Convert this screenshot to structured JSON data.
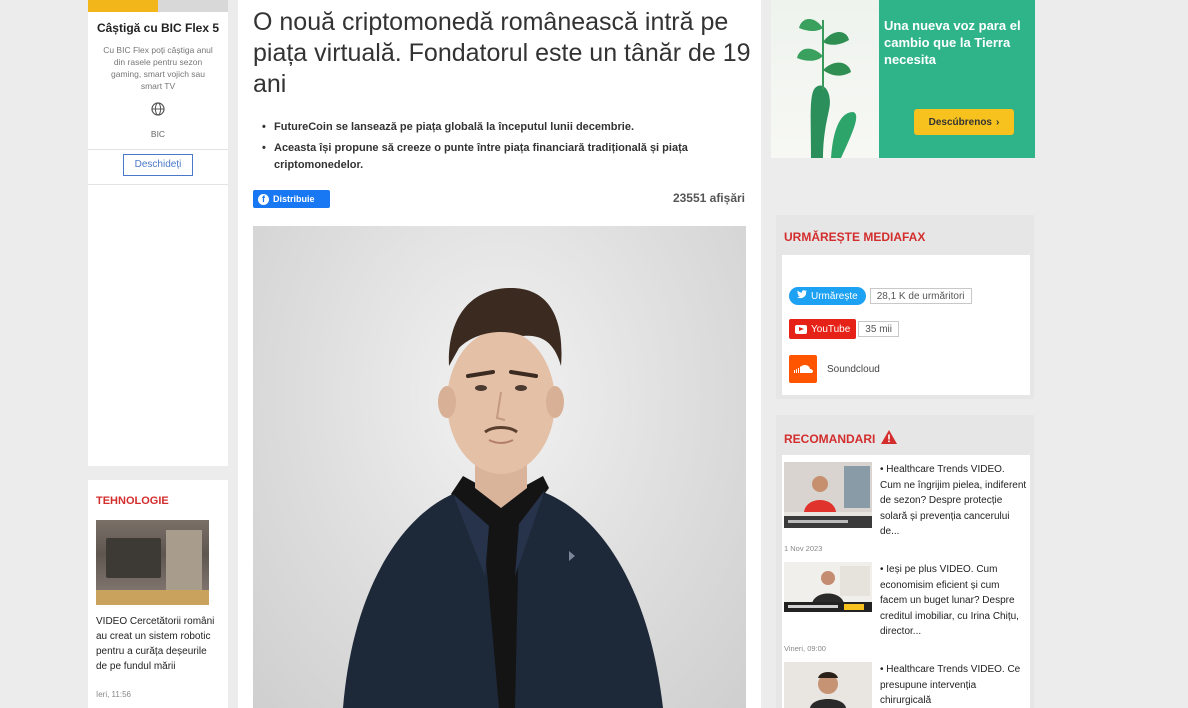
{
  "left_ad": {
    "title": "Câștigă cu BIC Flex 5",
    "description": "Cu BIC Flex poți câștiga anul din rasele pentru sezon gaming, smart vojich sau smart TV",
    "brand": "BIC",
    "open_label": "Deschideți"
  },
  "tech": {
    "heading": "TEHNOLOGIE",
    "title": "VIDEO Cercetătorii români au creat un sistem robotic pentru a curăța deșeurile de pe fundul mării",
    "time": "Ieri, 11:56"
  },
  "article": {
    "headline": "O nouă criptomonedă românească intră pe piața virtuală. Fondatorul este un tânăr de 19 ani",
    "bullets": [
      "FutureCoin se lansează pe piața globală la începutul lunii decembrie.",
      "Aceasta își propune să creeze o punte între piața financiară tradițională și piața criptomonedelor."
    ],
    "share_label": "Distribuie",
    "views": "23551 afișări"
  },
  "right_ad": {
    "slogan": "Una nueva voz para el cambio que la Tierra necesita",
    "cta": "Descúbrenos"
  },
  "follow": {
    "heading": "URMĂREȘTE MEDIAFAX",
    "twitter_label": "Urmărește",
    "twitter_count": "28,1 K de urmăritori",
    "youtube_label": "YouTube",
    "youtube_count": "35 mii",
    "soundcloud_label": "Soundcloud"
  },
  "reco": {
    "heading": "RECOMANDARI",
    "items": [
      {
        "title": "Healthcare Trends VIDEO. Cum ne îngrijim pielea, indiferent de sezon? Despre protecție solară și prevenția cancerului de...",
        "date": "1 Nov 2023"
      },
      {
        "title": "Ieși pe plus VIDEO. Cum economisim eficient și cum facem un buget lunar? Despre creditul imobiliar, cu Irina Chițu, director...",
        "date": "Vineri, 09:00"
      },
      {
        "title": "Healthcare Trends VIDEO. Ce presupune intervenția chirurgicală",
        "date": ""
      }
    ]
  },
  "colors": {
    "accent_red": "#d32d2d",
    "facebook_blue": "#1877f2",
    "twitter_blue": "#1da1f2",
    "youtube_red": "#e62117",
    "soundcloud_orange": "#ff5500",
    "ad_green": "#2fb48a",
    "ad_yellow": "#f7c21e"
  },
  "icons": [
    "globe-icon",
    "facebook-icon",
    "twitter-icon",
    "youtube-icon",
    "soundcloud-icon",
    "warning-icon",
    "chevron-right-icon"
  ]
}
